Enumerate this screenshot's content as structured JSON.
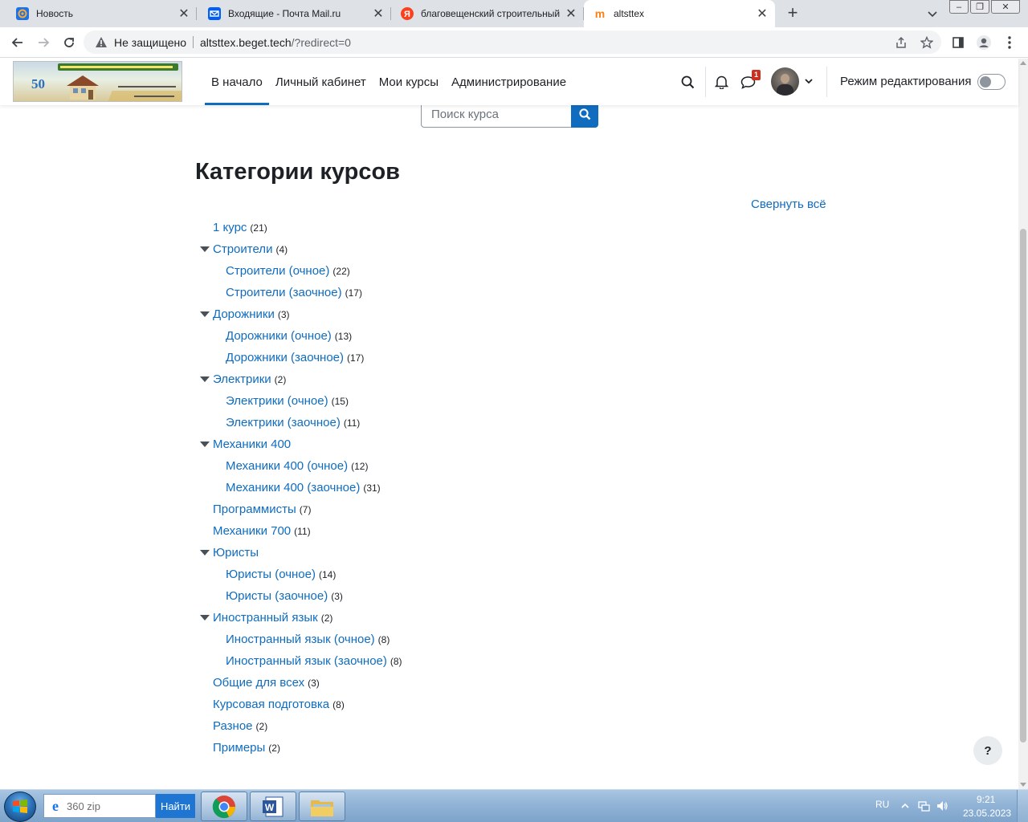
{
  "browser": {
    "tabs": [
      {
        "title": "Новость",
        "favicon": "mail-at-icon",
        "active": false
      },
      {
        "title": "Входящие - Почта Mail.ru",
        "favicon": "mail-envelope-icon",
        "active": false
      },
      {
        "title": "благовещенский строительный",
        "favicon": "yandex-icon",
        "active": false
      },
      {
        "title": "altsttex",
        "favicon": "moodle-icon",
        "active": true
      }
    ],
    "new_tab": "+",
    "security_label": "Не защищено",
    "url_host": "altsttex.beget.tech",
    "url_path": "/?redirect=0"
  },
  "navbar": {
    "menu": [
      {
        "label": "В начало",
        "active": true
      },
      {
        "label": "Личный кабинет",
        "active": false
      },
      {
        "label": "Мои курсы",
        "active": false
      },
      {
        "label": "Администрирование",
        "active": false
      }
    ],
    "message_count": "1",
    "edit_mode_label": "Режим редактирования",
    "edit_mode_on": false
  },
  "page": {
    "search_placeholder": "Поиск курса",
    "title": "Категории курсов",
    "collapse_all": "Свернуть всё",
    "categories": [
      {
        "name": "1 курс",
        "count": "(21)",
        "level": 0,
        "expanded": false
      },
      {
        "name": "Строители",
        "count": "(4)",
        "level": 0,
        "expanded": true
      },
      {
        "name": "Строители (очное)",
        "count": "(22)",
        "level": 1,
        "expanded": false
      },
      {
        "name": "Строители (заочное)",
        "count": "(17)",
        "level": 1,
        "expanded": false
      },
      {
        "name": "Дорожники",
        "count": "(3)",
        "level": 0,
        "expanded": true
      },
      {
        "name": "Дорожники (очное)",
        "count": "(13)",
        "level": 1,
        "expanded": false
      },
      {
        "name": "Дорожники (заочное)",
        "count": "(17)",
        "level": 1,
        "expanded": false
      },
      {
        "name": "Электрики",
        "count": "(2)",
        "level": 0,
        "expanded": true
      },
      {
        "name": "Электрики (очное)",
        "count": "(15)",
        "level": 1,
        "expanded": false
      },
      {
        "name": "Электрики (заочное)",
        "count": "(11)",
        "level": 1,
        "expanded": false
      },
      {
        "name": "Механики 400",
        "count": "",
        "level": 0,
        "expanded": true
      },
      {
        "name": "Механики 400 (очное)",
        "count": "(12)",
        "level": 1,
        "expanded": false
      },
      {
        "name": "Механики 400 (заочное)",
        "count": "(31)",
        "level": 1,
        "expanded": false
      },
      {
        "name": "Программисты",
        "count": "(7)",
        "level": 0,
        "expanded": false
      },
      {
        "name": "Механики 700",
        "count": "(11)",
        "level": 0,
        "expanded": false
      },
      {
        "name": "Юристы",
        "count": "",
        "level": 0,
        "expanded": true
      },
      {
        "name": "Юристы (очное)",
        "count": "(14)",
        "level": 1,
        "expanded": false
      },
      {
        "name": "Юристы (заочное)",
        "count": "(3)",
        "level": 1,
        "expanded": false
      },
      {
        "name": "Иностранный язык",
        "count": "(2)",
        "level": 0,
        "expanded": true
      },
      {
        "name": "Иностранный язык (очное)",
        "count": "(8)",
        "level": 1,
        "expanded": false
      },
      {
        "name": "Иностранный язык (заочное)",
        "count": "(8)",
        "level": 1,
        "expanded": false
      },
      {
        "name": "Общие для всех",
        "count": "(3)",
        "level": 0,
        "expanded": false
      },
      {
        "name": "Курсовая подготовка",
        "count": "(8)",
        "level": 0,
        "expanded": false
      },
      {
        "name": "Разное",
        "count": "(2)",
        "level": 0,
        "expanded": false
      },
      {
        "name": "Примеры",
        "count": "(2)",
        "level": 0,
        "expanded": false
      }
    ],
    "help": "?"
  },
  "taskbar": {
    "search_value": "360 zip",
    "search_button": "Найти",
    "apps": [
      "chrome-icon",
      "word-icon",
      "explorer-folder-icon"
    ],
    "language": "RU",
    "time": "9:21",
    "date": "23.05.2023"
  },
  "colors": {
    "link": "#0f6cbf",
    "tab_strip": "#dee1e6",
    "badge": "#ca3120"
  }
}
